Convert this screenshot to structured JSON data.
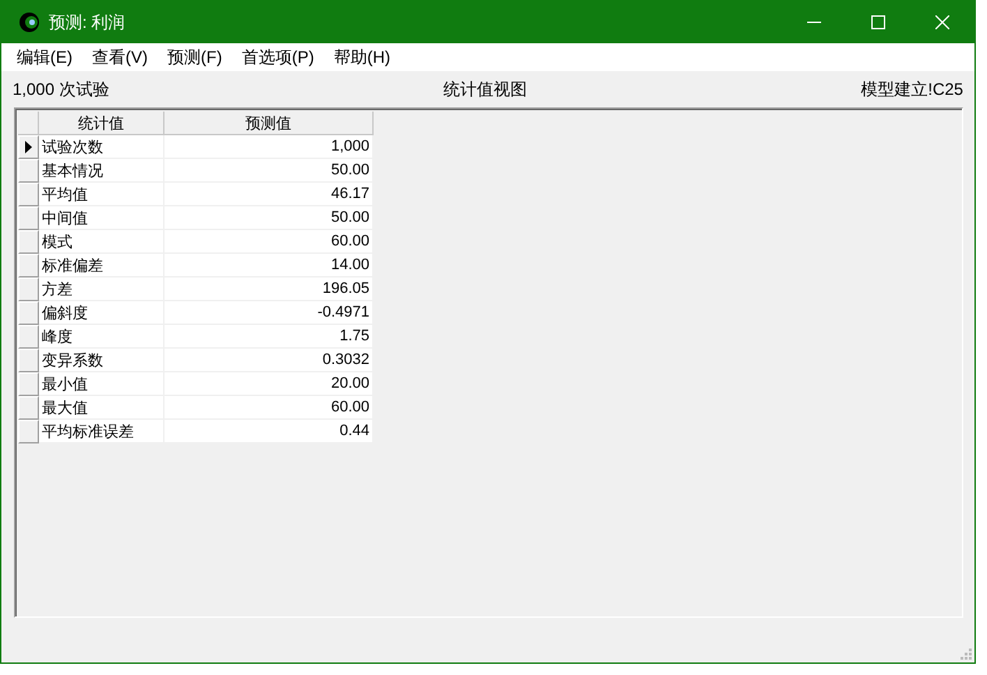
{
  "window": {
    "title": "预测: 利润"
  },
  "menu": [
    "编辑(E)",
    "查看(V)",
    "预测(F)",
    "首选项(P)",
    "帮助(H)"
  ],
  "info": {
    "trials": "1,000 次试验",
    "view": "统计值视图",
    "cell": "模型建立!C25"
  },
  "table": {
    "columns": [
      "统计值",
      "预测值"
    ],
    "rows": [
      {
        "name": "试验次数",
        "value": "1,000",
        "selected": true
      },
      {
        "name": "基本情况",
        "value": "50.00",
        "selected": false
      },
      {
        "name": "平均值",
        "value": "46.17",
        "selected": false
      },
      {
        "name": "中间值",
        "value": "50.00",
        "selected": false
      },
      {
        "name": "模式",
        "value": "60.00",
        "selected": false
      },
      {
        "name": "标准偏差",
        "value": "14.00",
        "selected": false
      },
      {
        "name": "方差",
        "value": "196.05",
        "selected": false
      },
      {
        "name": "偏斜度",
        "value": "-0.4971",
        "selected": false
      },
      {
        "name": "峰度",
        "value": "1.75",
        "selected": false
      },
      {
        "name": "变异系数",
        "value": "0.3032",
        "selected": false
      },
      {
        "name": "最小值",
        "value": "20.00",
        "selected": false
      },
      {
        "name": "最大值",
        "value": "60.00",
        "selected": false
      },
      {
        "name": "平均标准误差",
        "value": "0.44",
        "selected": false
      }
    ]
  }
}
